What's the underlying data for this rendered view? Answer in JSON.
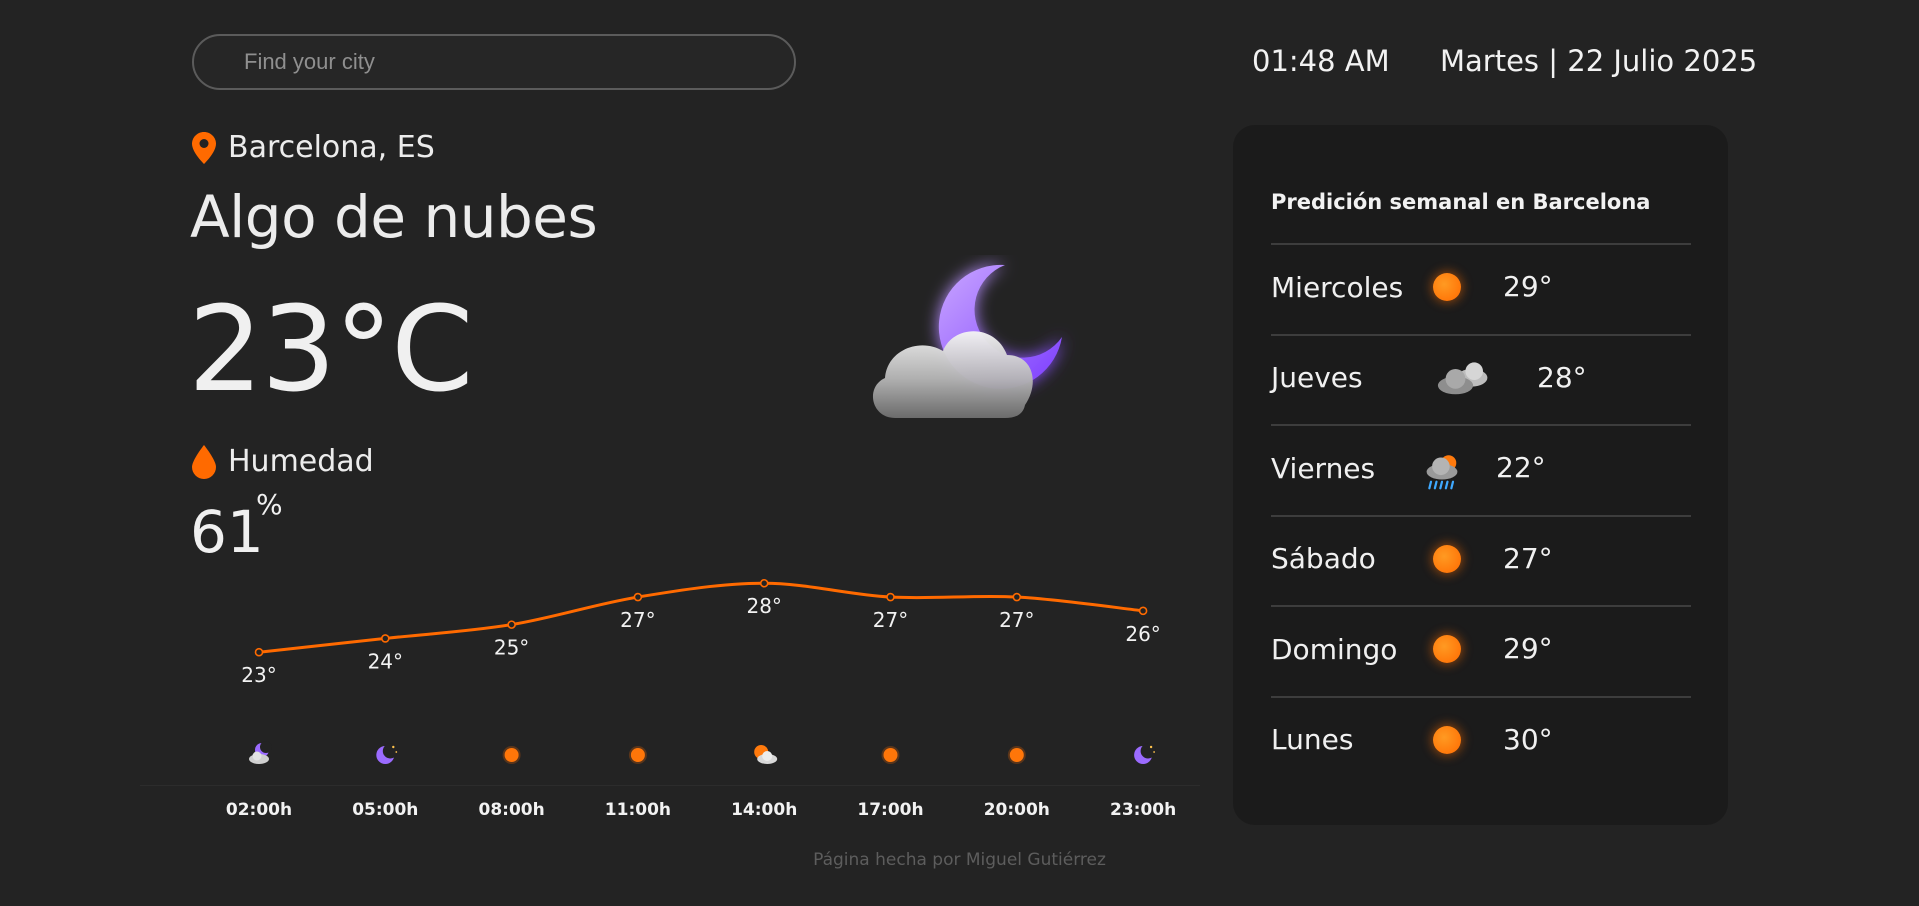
{
  "search": {
    "placeholder": "Find your city",
    "value": ""
  },
  "time": "01:48 AM",
  "date": "Martes | 22 Julio 2025",
  "location": "Barcelona, ES",
  "condition": "Algo de nubes",
  "temperature": "23°C",
  "humidity": {
    "label": "Humedad",
    "value": "61",
    "unit": "%"
  },
  "main_icon": "night-cloud-moon-icon",
  "chart_data": {
    "type": "line",
    "x": [
      "02:00h",
      "05:00h",
      "08:00h",
      "11:00h",
      "14:00h",
      "17:00h",
      "20:00h",
      "23:00h"
    ],
    "values": [
      23,
      24,
      25,
      27,
      28,
      27,
      27,
      26
    ],
    "value_labels": [
      "23°",
      "24°",
      "25°",
      "27°",
      "28°",
      "27°",
      "27°",
      "26°"
    ],
    "icons": [
      "night-cloud-icon",
      "moon-stars-icon",
      "sun-icon",
      "sun-icon",
      "sun-cloud-icon",
      "sun-icon",
      "sun-icon",
      "moon-stars-icon"
    ],
    "line_color": "#ff6a00",
    "ylim": [
      22,
      29
    ]
  },
  "weekly": {
    "title": "Predición semanal en Barcelona",
    "days": [
      {
        "name": "Miercoles",
        "temp": "29°",
        "icon": "sun-icon"
      },
      {
        "name": "Jueves",
        "temp": "28°",
        "icon": "clouds-icon"
      },
      {
        "name": "Viernes",
        "temp": "22°",
        "icon": "rain-sun-icon"
      },
      {
        "name": "Sábado",
        "temp": "27°",
        "icon": "sun-icon"
      },
      {
        "name": "Domingo",
        "temp": "29°",
        "icon": "sun-icon"
      },
      {
        "name": "Lunes",
        "temp": "30°",
        "icon": "sun-icon"
      }
    ]
  },
  "footer": "Página hecha por Miguel Gutiérrez",
  "colors": {
    "accent": "#ff6a00",
    "background": "#232323",
    "panel": "#1b1b1b",
    "moon": "#8a5cff"
  }
}
